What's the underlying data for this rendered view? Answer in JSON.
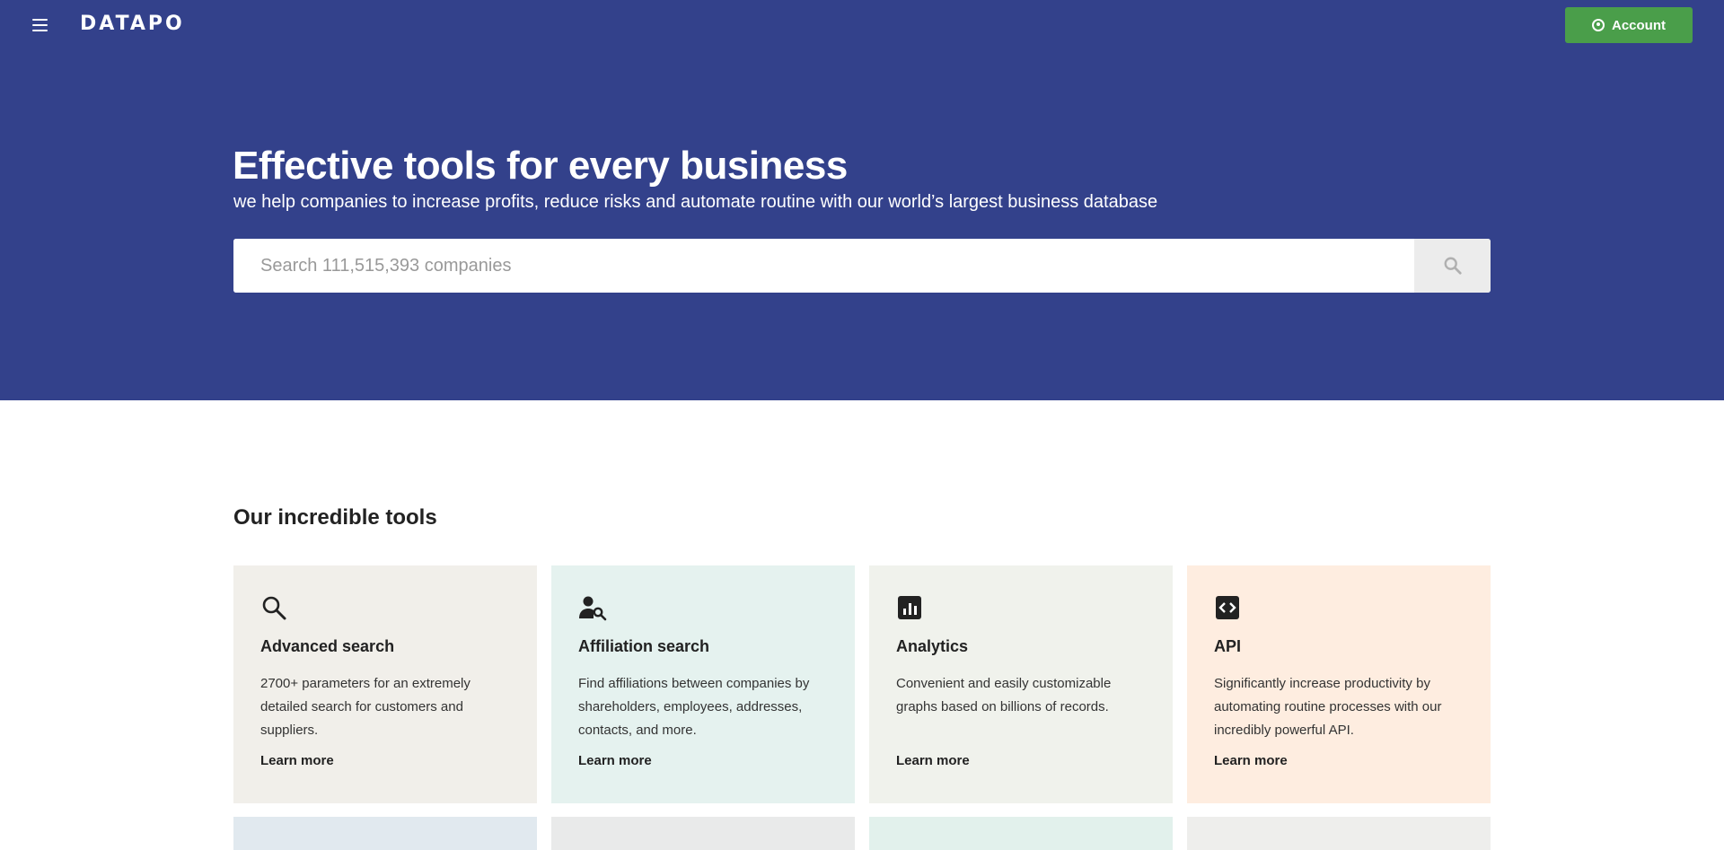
{
  "header": {
    "logo": "DATAPO",
    "account_label": "Account"
  },
  "hero": {
    "title": "Effective tools for every business",
    "subtitle": "we help companies to increase profits, reduce risks and automate routine with our world’s largest business database",
    "search_placeholder": "Search 111,515,393 companies"
  },
  "tools": {
    "title": "Our incredible tools",
    "cards": [
      {
        "icon": "search-icon",
        "title": "Advanced search",
        "description": "2700+ parameters for an extremely detailed search for customers and suppliers.",
        "link": "Learn more",
        "bg": "#f1efea"
      },
      {
        "icon": "person-search-icon",
        "title": "Affiliation search",
        "description": "Find affiliations between companies by shareholders, employees, addresses, contacts, and more.",
        "link": "Learn more",
        "bg": "#e5f2ef"
      },
      {
        "icon": "analytics-icon",
        "title": "Analytics",
        "description": "Convenient and easily customizable graphs based on billions of records.",
        "link": "Learn more",
        "bg": "#f0f2ec"
      },
      {
        "icon": "code-icon",
        "title": "API",
        "description": "Significantly increase productivity by automating routine processes with our incredibly powerful API.",
        "link": "Learn more",
        "bg": "#feede0"
      }
    ],
    "next_row_colors": [
      "#e1e9ef",
      "#e9eaea",
      "#e2f1ec",
      "#eeeeec"
    ]
  }
}
